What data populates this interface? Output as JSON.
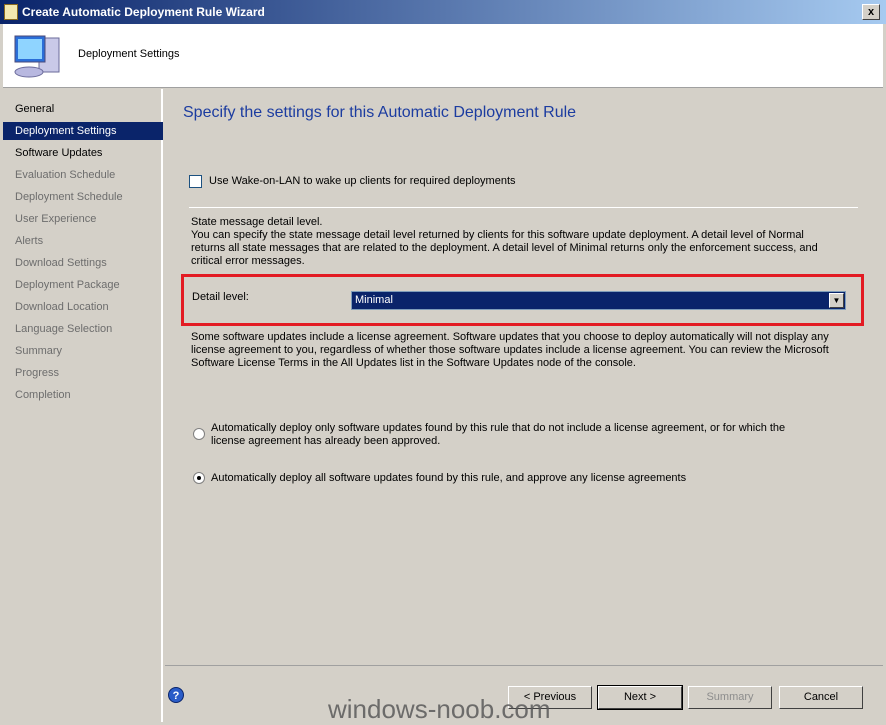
{
  "window": {
    "title": "Create Automatic Deployment Rule Wizard",
    "close_label": "x"
  },
  "header": {
    "title": "Deployment Settings"
  },
  "sidebar": {
    "items": [
      {
        "label": "General",
        "state": "done"
      },
      {
        "label": "Deployment Settings",
        "state": "active"
      },
      {
        "label": "Software Updates",
        "state": "done"
      },
      {
        "label": "Evaluation Schedule",
        "state": "future"
      },
      {
        "label": "Deployment Schedule",
        "state": "future"
      },
      {
        "label": "User Experience",
        "state": "future"
      },
      {
        "label": "Alerts",
        "state": "future"
      },
      {
        "label": "Download Settings",
        "state": "future"
      },
      {
        "label": "Deployment Package",
        "state": "future"
      },
      {
        "label": "Download Location",
        "state": "future"
      },
      {
        "label": "Language Selection",
        "state": "future"
      },
      {
        "label": "Summary",
        "state": "future"
      },
      {
        "label": "Progress",
        "state": "future"
      },
      {
        "label": "Completion",
        "state": "future"
      }
    ]
  },
  "main": {
    "title": "Specify the settings for this Automatic Deployment Rule",
    "wol_checkbox": {
      "label": "Use Wake-on-LAN to wake up clients for required deployments",
      "checked": false
    },
    "state_heading": "State message detail level.",
    "state_description": "You can specify the state message detail level returned by clients for this software update deployment.  A detail level of Normal returns all state messages that are related to the deployment.  A detail level of Minimal returns only the enforcement success, and critical error messages.",
    "detail_level": {
      "label": "Detail level:",
      "value": "Minimal"
    },
    "license_note": "Some software updates include a license agreement.  Software updates that you choose to deploy automatically will not display any license agreement to you, regardless of whether those software updates include a license agreement. You can review the Microsoft Software License Terms in the All Updates list in the Software Updates node of the console.",
    "radio_options": [
      {
        "label": "Automatically deploy only software updates found by this rule that do not include a license agreement, or for which the license agreement has already been approved.",
        "selected": false
      },
      {
        "label": "Automatically deploy all software updates found by this rule, and approve any license agreements",
        "selected": true
      }
    ]
  },
  "footer": {
    "help_label": "?",
    "previous": "< Previous",
    "next": "Next >",
    "summary": "Summary",
    "cancel": "Cancel"
  },
  "watermark": "windows-noob.com",
  "colors": {
    "highlight": "#e31b23",
    "selection": "#0a246a",
    "title_text": "#1c3ca0"
  }
}
